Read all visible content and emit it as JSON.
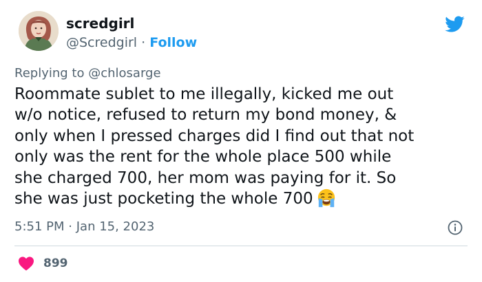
{
  "author": {
    "name": "scredgirl",
    "handle": "@Scredgirl",
    "separator": "·",
    "follow_label": "Follow"
  },
  "reply": {
    "prefix": "Replying to",
    "mention": "@chlosarge"
  },
  "tweet": {
    "lines": [
      "Roommate sublet to me illegally, kicked me out",
      "w/o notice, refused to return my bond money, &",
      "only when I pressed charges did I find out that not",
      "only was the rent for the whole place 500 while",
      "she charged 700, her mom was paying for it. So",
      "she was just pocketing the whole 700"
    ],
    "emoji": "crying-face-emoji"
  },
  "timestamp": {
    "time": "5:51 PM",
    "separator": "·",
    "date": "Jan 15, 2023"
  },
  "likes": {
    "count": "899"
  },
  "colors": {
    "brand_blue": "#1d9bf0",
    "heart_red": "#f91880",
    "secondary_text": "#536471",
    "primary_text": "#0f1419",
    "divider": "#cfd9de"
  },
  "icons": [
    "avatar",
    "twitter-bird-icon",
    "info-icon",
    "heart-icon",
    "crying-face-emoji"
  ]
}
